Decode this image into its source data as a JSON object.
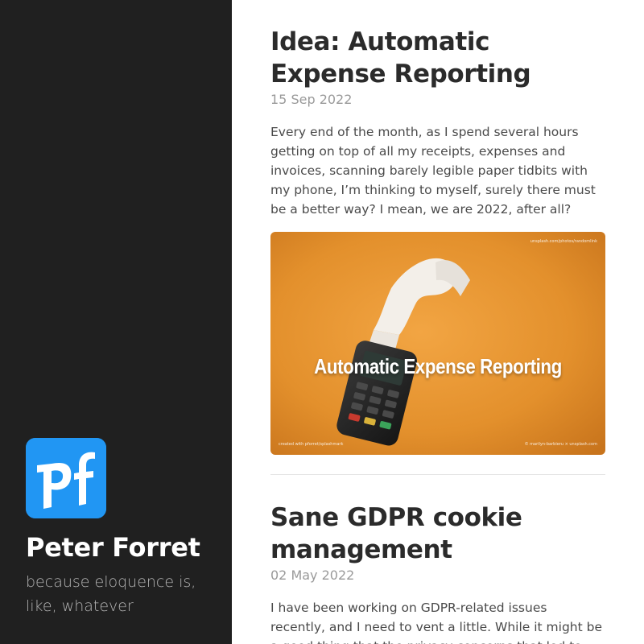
{
  "sidebar": {
    "logo_text": "pf",
    "site_title": "Peter Forret",
    "tagline": "because eloquence is, like, whatever"
  },
  "posts": [
    {
      "title": "Idea: Automatic Expense Reporting",
      "date": "15 Sep 2022",
      "excerpt": "Every end of the month, as I spend several hours getting on top of all my receipts, expenses and invoices, scanning barely legible paper tidbits with my phone, I’m thinking to myself, surely there must be a better way? I mean, we are 2022, after all?",
      "image": {
        "overlay_title": "Automatic Expense Reporting",
        "credit_top": "unsplash.com/photos/randomlink",
        "credit_bottom_left": "created with pforret/splashmark",
        "credit_bottom_right": "© marilyn-barbieru × unsplash.com"
      }
    },
    {
      "title": "Sane GDPR cookie management",
      "date": "02 May 2022",
      "excerpt": "I have been working on GDPR-related issues recently, and I need to vent a little. While it might be a good thing that the privacy concerns that led to GDPR are raised"
    }
  ],
  "colors": {
    "sidebar_bg": "#202020",
    "logo_bg": "#2196f3",
    "image_bg": "#e8952e"
  }
}
